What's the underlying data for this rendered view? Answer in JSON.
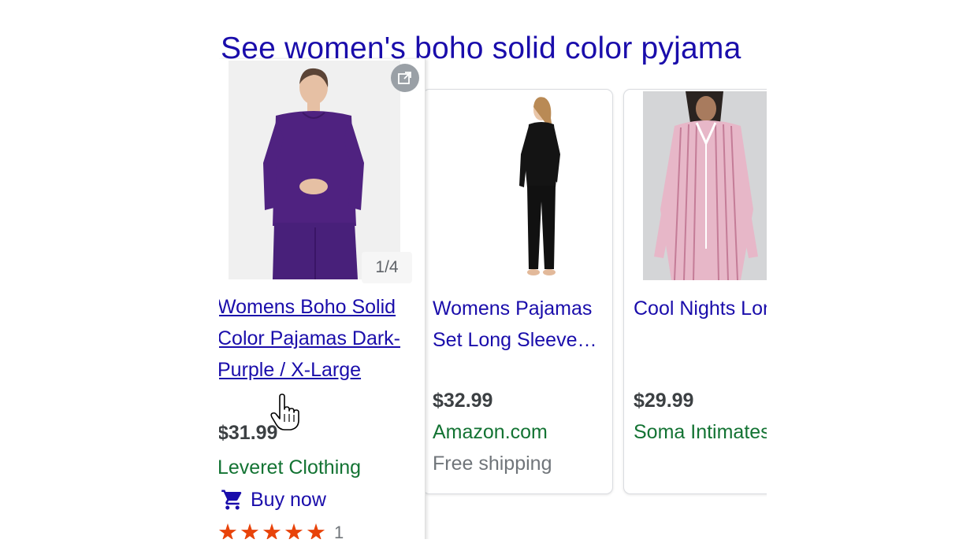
{
  "heading": "See women's boho solid color pyjama",
  "products": [
    {
      "title": "Womens Boho Solid Color Pajamas Dark-Purple / X-Large",
      "price": "$31.99",
      "store": "Leveret Clothing",
      "image_counter": "1/4",
      "buy_label": "Buy now",
      "rating_count": "1",
      "rating_stars": 5
    },
    {
      "title": "Womens Pajamas Set Long Sleeve…",
      "price": "$32.99",
      "store": "Amazon.com",
      "shipping": "Free shipping"
    },
    {
      "title": "Cool Nights Long Sleeve Notch Collar Pajama",
      "price": "$29.99",
      "store": "Soma Intimates"
    }
  ],
  "colors": {
    "link": "#1a0dab",
    "store": "#137333",
    "price": "#3c4043",
    "stars": "#e8430a"
  },
  "icons": [
    "open-in-new-icon",
    "shopping-cart-icon",
    "star-icon",
    "hand-pointer-cursor-icon"
  ]
}
